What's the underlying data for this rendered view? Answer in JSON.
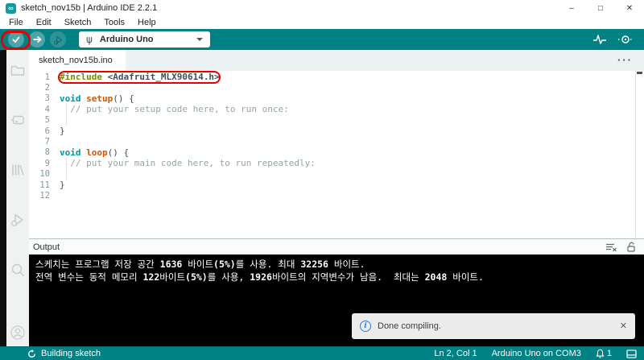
{
  "colors": {
    "accent_teal": "#008184",
    "annotation_red": "#e60000",
    "code_keyword": "#00979c",
    "code_function": "#d35400",
    "code_preprocessor": "#728e00",
    "code_plain": "#434f54",
    "code_comment": "#95a5a6",
    "console_bg": "#000000",
    "info_blue": "#2d7fd3"
  },
  "title_bar": {
    "title": "sketch_nov15b | Arduino IDE 2.2.1",
    "app_icon_glyph": "∞",
    "minimize": "–",
    "maximize": "□",
    "close": "✕"
  },
  "menu_bar": {
    "items": [
      "File",
      "Edit",
      "Sketch",
      "Tools",
      "Help"
    ]
  },
  "toolbar": {
    "verify": "verify",
    "upload": "upload",
    "debug": "debug",
    "board_selected": "Arduino Uno",
    "right_icons": [
      "serial-plotter",
      "serial-monitor"
    ]
  },
  "tab_bar": {
    "active_tab": "sketch_nov15b.ino",
    "more": "···"
  },
  "editor": {
    "lines": [
      {
        "num": "1",
        "boxed": true,
        "segments": [
          {
            "c": "pre",
            "t": "#include"
          },
          {
            "c": "inc",
            "t": " <Adafruit_MLX90614.h>"
          }
        ]
      },
      {
        "num": "2",
        "segments": []
      },
      {
        "num": "3",
        "segments": [
          {
            "c": "kw",
            "t": "void"
          },
          {
            "c": "pl",
            "t": " "
          },
          {
            "c": "fn",
            "t": "setup"
          },
          {
            "c": "pl",
            "t": "() {"
          }
        ]
      },
      {
        "num": "4",
        "guide": true,
        "segments": [
          {
            "c": "cm",
            "t": "  // put your setup code here, to run once:"
          }
        ]
      },
      {
        "num": "5",
        "guide": true,
        "segments": []
      },
      {
        "num": "6",
        "segments": [
          {
            "c": "pl",
            "t": "}"
          }
        ]
      },
      {
        "num": "7",
        "segments": []
      },
      {
        "num": "8",
        "segments": [
          {
            "c": "kw",
            "t": "void"
          },
          {
            "c": "pl",
            "t": " "
          },
          {
            "c": "fn",
            "t": "loop"
          },
          {
            "c": "pl",
            "t": "() {"
          }
        ]
      },
      {
        "num": "9",
        "guide": true,
        "segments": [
          {
            "c": "cm",
            "t": "  // put your main code here, to run repeatedly:"
          }
        ]
      },
      {
        "num": "10",
        "guide": true,
        "segments": []
      },
      {
        "num": "11",
        "segments": [
          {
            "c": "pl",
            "t": "}"
          }
        ]
      },
      {
        "num": "12",
        "segments": []
      }
    ]
  },
  "output": {
    "title": "Output",
    "console_lines": [
      [
        {
          "t": "스케치는 프로그램 저장 공간 "
        },
        {
          "t": "1636",
          "b": true
        },
        {
          "t": " 바이트"
        },
        {
          "t": "(5%)",
          "b": true
        },
        {
          "t": "를 사용. 최대 "
        },
        {
          "t": "32256",
          "b": true
        },
        {
          "t": " 바이트."
        }
      ],
      [
        {
          "t": "전역 변수는 동적 메모리 "
        },
        {
          "t": "122",
          "b": true
        },
        {
          "t": "바이트"
        },
        {
          "t": "(5%)",
          "b": true
        },
        {
          "t": "를 사용, "
        },
        {
          "t": "1926",
          "b": true
        },
        {
          "t": "바이트의 지역변수가 남음.  최대는 "
        },
        {
          "t": "2048",
          "b": true
        },
        {
          "t": " 바이트."
        }
      ]
    ]
  },
  "notification": {
    "message": "Done compiling.",
    "info_glyph": "i",
    "close": "✕"
  },
  "status_bar": {
    "building": "Building sketch",
    "position": "Ln 2, Col 1",
    "board": "Arduino Uno on COM3",
    "notification_count": "1"
  },
  "annotations": {
    "color": "#e60000",
    "boxes": [
      "verify-button",
      "include-line-1"
    ]
  }
}
